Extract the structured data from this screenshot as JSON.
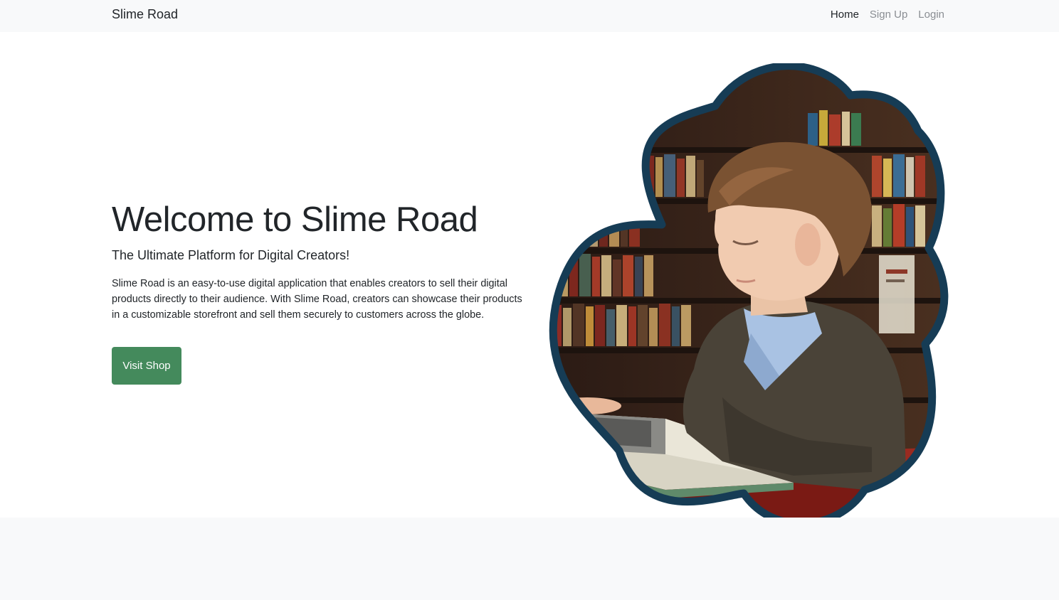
{
  "navbar": {
    "brand": "Slime Road",
    "links": [
      {
        "label": "Home",
        "active": true
      },
      {
        "label": "Sign Up",
        "active": false
      },
      {
        "label": "Login",
        "active": false
      }
    ]
  },
  "hero": {
    "title": "Welcome to Slime Road",
    "subtitle": "The Ultimate Platform for Digital Creators!",
    "description": "Slime Road is an easy-to-use digital application that enables creators to sell their digital products directly to their audience. With Slime Road, creators can showcase their products in a customizable storefront and sell them securely to customers across the globe.",
    "button_label": "Visit Shop",
    "image_subject": "boy-reading-book-in-library"
  },
  "colors": {
    "navbar_bg": "#f8f9fa",
    "button_bg": "#448a5c",
    "image_frame": "#163c55",
    "footer_bg": "#f8f9fa"
  }
}
